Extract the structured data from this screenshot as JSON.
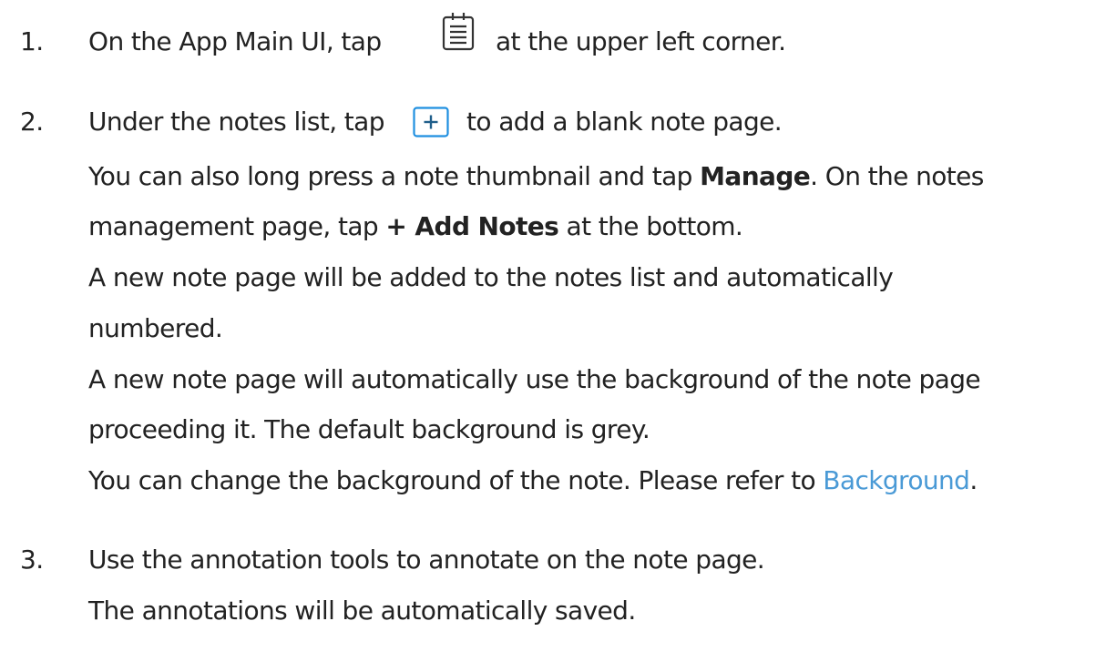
{
  "steps": [
    {
      "number": "1.",
      "text_before": "On the App Main UI, tap",
      "icon": "notes-list-icon",
      "text_after": "at the upper left corner."
    },
    {
      "number": "2.",
      "text_before": "Under the notes list, tap",
      "icon": "add-note-icon",
      "text_after": "to add a blank note page.",
      "paragraphs": {
        "p1_a": "You can also long press a note thumbnail and tap ",
        "p1_bold1": "Manage",
        "p1_b": ". On the notes",
        "p1_c": "management page, tap ",
        "p1_bold2": "+ Add Notes",
        "p1_d": " at the bottom.",
        "p2_a": "A new note page will be added to the notes list and automatically",
        "p2_b": "numbered.",
        "p3_a": "A new note page will automatically use the background of the note page",
        "p3_b": "proceeding it. The default background is grey.",
        "p4_a": "You can change the background of the note. Please refer to ",
        "p4_link": "Background",
        "p4_b": "."
      }
    },
    {
      "number": "3.",
      "text": "Use the annotation tools to annotate on the note page.",
      "subtext": "The annotations will be automatically saved."
    }
  ],
  "colors": {
    "text": "#222222",
    "link": "#4a9ad6",
    "icon_border": "#1f8fe0"
  }
}
